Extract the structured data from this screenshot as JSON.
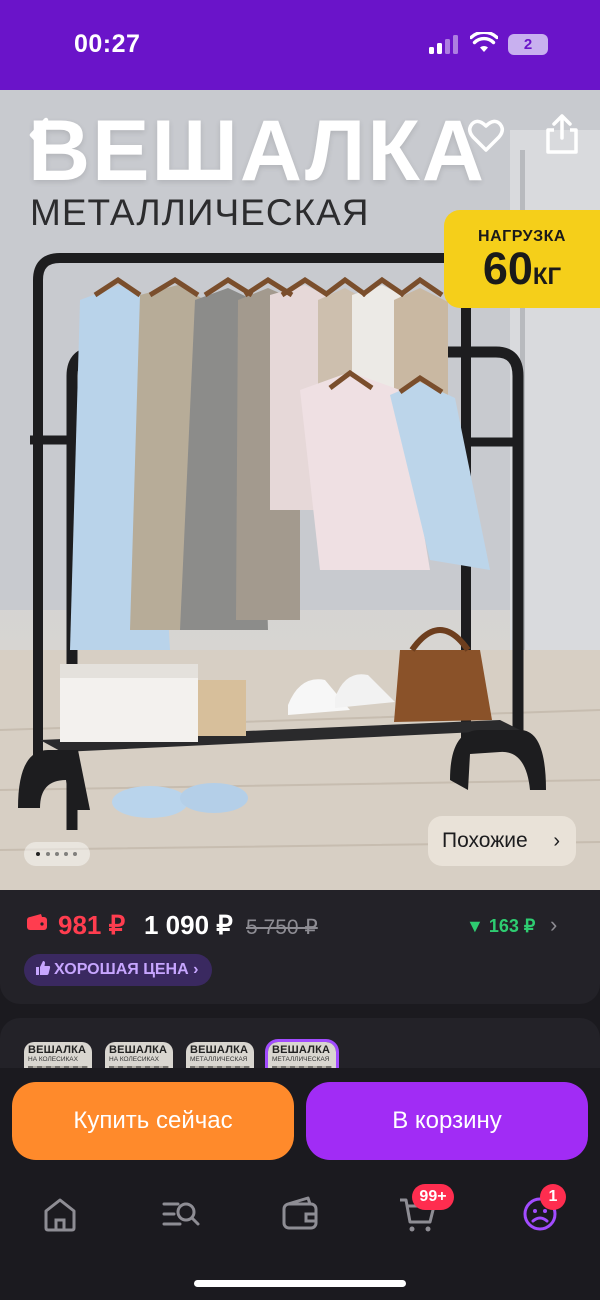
{
  "status_bar": {
    "time": "00:27",
    "battery_label": "2",
    "background": "#6a14c9"
  },
  "hero": {
    "title": "ВЕШАЛКА",
    "subtitle": "МЕТАЛЛИЧЕСКАЯ",
    "badge_top": "НАГРУЗКА",
    "badge_value": "60",
    "badge_unit": "КГ",
    "similar_label": "Похожие",
    "image_count": 5,
    "current_image": 1,
    "icons": {
      "back": "chevron-left-icon",
      "favorite": "heart-icon",
      "share": "share-icon"
    }
  },
  "price": {
    "wallet_price": "981 ₽",
    "regular_price": "1 090 ₽",
    "old_price": "5 750 ₽",
    "price_drop": "163 ₽",
    "good_price_label": "ХОРОШАЯ ЦЕНА",
    "colors": {
      "wallet": "#ff3d4f",
      "drop": "#2ecc71",
      "badge": "#c7a6ff"
    }
  },
  "options": {
    "items": [
      {
        "title": "ВЕШАЛКА",
        "caption": "НА КОЛЕСИКАХ"
      },
      {
        "title": "ВЕШАЛКА",
        "caption": "НА КОЛЕСИКАХ"
      },
      {
        "title": "ВЕШАЛКА",
        "caption": "МЕТАЛЛИЧЕСКАЯ"
      },
      {
        "title": "ВЕШАЛКА",
        "caption": "МЕТАЛЛИЧЕСКАЯ"
      }
    ],
    "selected_index": 3
  },
  "actions": {
    "buy_label": "Купить сейчас",
    "cart_label": "В корзину",
    "colors": {
      "buy": "#ff8a2b",
      "cart": "#a12cf5"
    }
  },
  "nav": {
    "items": [
      {
        "icon": "home-icon"
      },
      {
        "icon": "catalog-search-icon"
      },
      {
        "icon": "wallet-icon"
      },
      {
        "icon": "cart-icon",
        "badge": "99+"
      },
      {
        "icon": "profile-icon",
        "badge": "1"
      }
    ]
  }
}
